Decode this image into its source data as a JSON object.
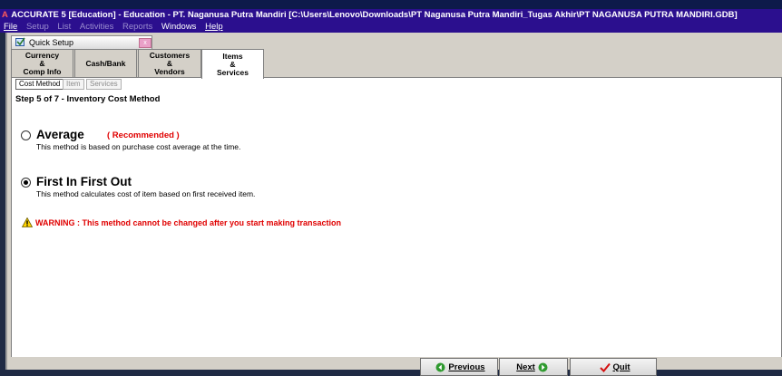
{
  "window": {
    "title": "ACCURATE 5 [Education] - Education - PT. Naganusa Putra Mandiri   [C:\\Users\\Lenovo\\Downloads\\PT Naganusa Putra Mandiri_Tugas Akhir\\PT NAGANUSA PUTRA MANDIRI.GDB]",
    "app_icon": "A"
  },
  "menu": [
    "File",
    "Setup",
    "List",
    "Activities",
    "Reports",
    "Windows",
    "Help"
  ],
  "child_window": {
    "title": "Quick Setup",
    "close_label": "x"
  },
  "tabs": [
    {
      "label": "Currency\n&\nComp Info"
    },
    {
      "label": "Cash/Bank"
    },
    {
      "label": "Customers\n&\nVendors"
    },
    {
      "label": "Items\n&\nServices"
    }
  ],
  "subtabs": [
    "Cost Method",
    "Item",
    "Services"
  ],
  "step_text": "Step 5 of 7  - Inventory Cost Method",
  "options": {
    "average": {
      "label": "Average",
      "recommended": "( Recommended )",
      "description": "This method is based on purchase cost average at the time."
    },
    "fifo": {
      "label": "First In First Out",
      "description": "This method calculates cost of item based on first received item."
    }
  },
  "selected_option": "fifo",
  "warning": "WARNING :  This method cannot be changed after you start making transaction",
  "buttons": {
    "previous": "Previous",
    "next": "Next",
    "quit": "Quit"
  },
  "colors": {
    "title_bg": "#2b0f8e",
    "warning": "#e00000",
    "active_tab": "#ffffff"
  }
}
